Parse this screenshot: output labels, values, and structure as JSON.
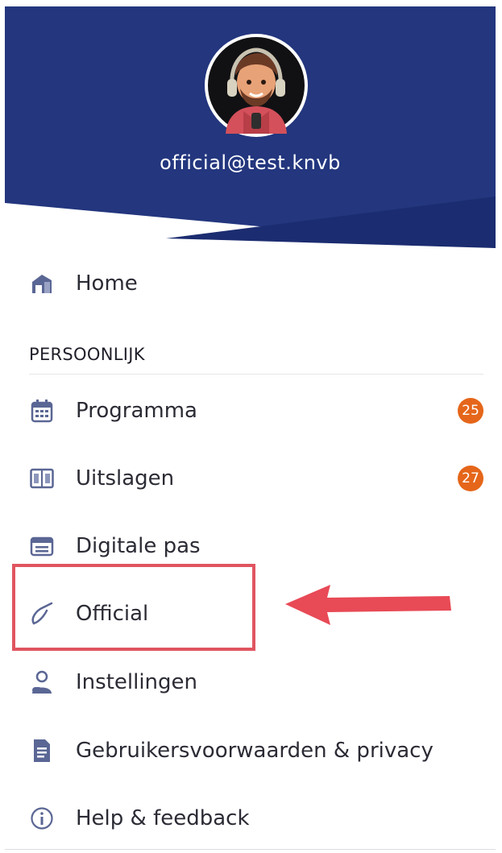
{
  "header": {
    "email": "official@test.knvb",
    "bg_color": "#23367e",
    "bg_color_secondary": "#1b2c70"
  },
  "menu": {
    "home": {
      "label": "Home",
      "icon": "home-icon"
    },
    "section_title": "PERSOONLIJK",
    "items": [
      {
        "label": "Programma",
        "icon": "calendar-icon",
        "badge": "25"
      },
      {
        "label": "Uitslagen",
        "icon": "scoreboard-icon",
        "badge": "27"
      },
      {
        "label": "Digitale pas",
        "icon": "card-icon"
      },
      {
        "label": "Official",
        "icon": "whistle-icon"
      },
      {
        "label": "Instellingen",
        "icon": "user-icon"
      },
      {
        "label": "Gebruikersvoorwaarden & privacy",
        "icon": "document-icon"
      },
      {
        "label": "Help & feedback",
        "icon": "info-icon"
      }
    ]
  },
  "colors": {
    "icon": "#5a6694",
    "badge": "#e5661a",
    "annotation": "#e05560"
  }
}
